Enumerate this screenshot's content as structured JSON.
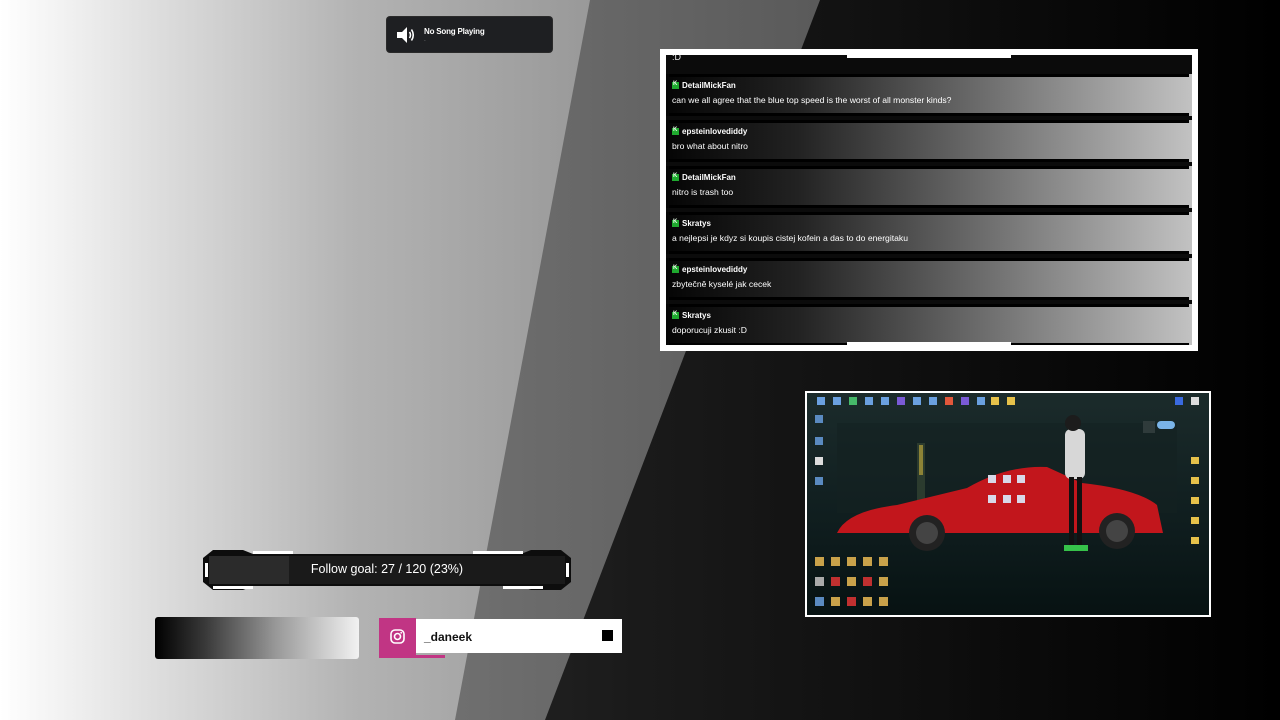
{
  "now_playing": {
    "title": "No Song Playing",
    "artist": "-"
  },
  "chat": {
    "previous_fragment": ":D",
    "messages": [
      {
        "user": "DetailMickFan",
        "text": "can we all agree that the blue top speed is the worst of all monster kinds?"
      },
      {
        "user": "epsteinlovediddy",
        "text": "bro what about nitro"
      },
      {
        "user": "DetailMickFan",
        "text": "nitro is trash too"
      },
      {
        "user": "Skratys",
        "text": "a nejlepsi je kdyz si koupis cistej kofein a das to do energitaku"
      },
      {
        "user": "epsteinlovediddy",
        "text": "zbytečně kyselé jak cecek"
      },
      {
        "user": "Skratys",
        "text": "doporucuji zkusit :D"
      }
    ]
  },
  "follow_goal": {
    "label": "Follow goal:  27 / 120 (23%)",
    "current": 27,
    "target": 120,
    "percent": 23
  },
  "instagram": {
    "handle": "_daneek",
    "accent": "#c13584"
  },
  "colors": {
    "badge_green": "#1faa2f",
    "car_red": "#c2161c"
  }
}
